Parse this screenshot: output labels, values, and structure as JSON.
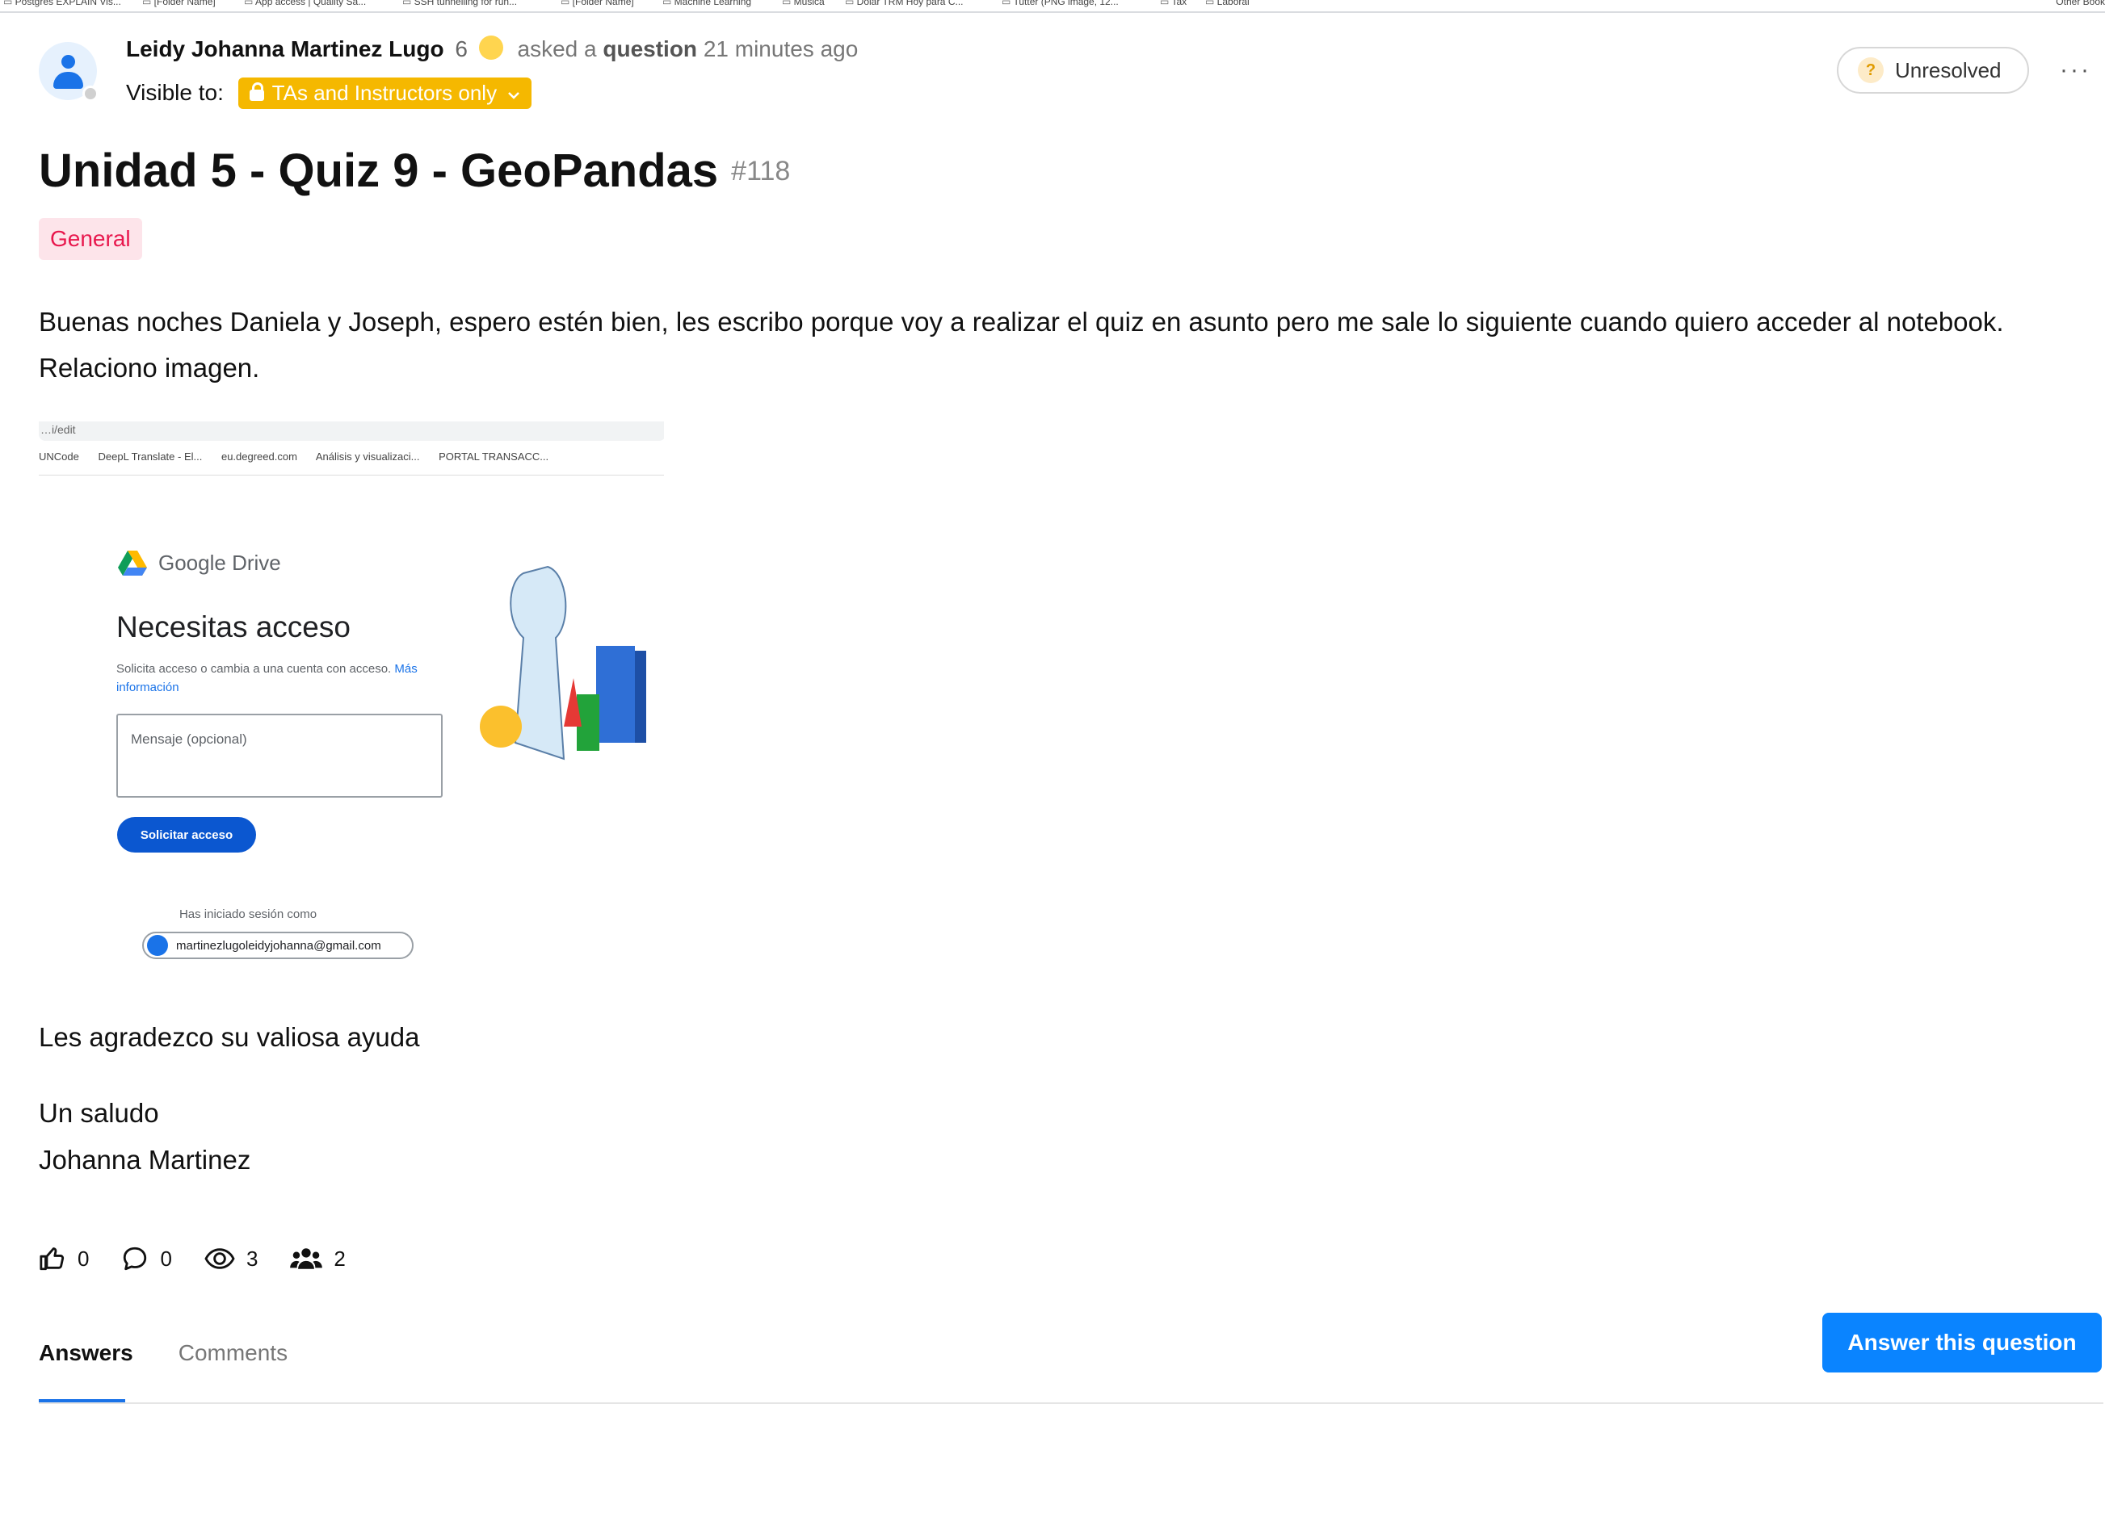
{
  "bookmarks": {
    "items": [
      "Postgres EXPLAIN Vis...",
      "[Folder Name]",
      "App access | Quality Sa...",
      "SSH tunnelling for run...",
      "[Folder Name]",
      "Machine Learning",
      "Musica",
      "Dolar TRM Hoy para C...",
      "Tutter (PNG image, 12...",
      "Tax",
      "Laboral"
    ],
    "other": "Other Book"
  },
  "post": {
    "author": "Leidy Johanna Martinez Lugo",
    "karma": "6",
    "asked_word": "asked a",
    "question_word": "question",
    "time": "21 minutes ago",
    "visible_label": "Visible to:",
    "visibility": "TAs and Instructors only",
    "status": "Unresolved",
    "more": "···",
    "title": "Unidad 5 - Quiz 9 - GeoPandas",
    "number": "#118",
    "tag": "General",
    "body_p1": "Buenas noches Daniela y Joseph, espero estén bien, les escribo porque voy a realizar el quiz en asunto pero me sale lo siguiente cuando quiero acceder al notebook. Relaciono imagen.",
    "body_p2": "Les agradezco su valiosa ayuda",
    "body_p3": "Un saludo",
    "body_p4": "Johanna Martinez"
  },
  "embedded_screenshot": {
    "url": "…i/edit",
    "bookmarks": [
      "UNCode",
      "DeepL Translate - El...",
      "eu.degreed.com",
      "Análisis y visualizaci...",
      "PORTAL TRANSACC..."
    ],
    "brand": "Google Drive",
    "heading": "Necesitas acceso",
    "subtitle": "Solicita acceso o cambia a una cuenta con acceso.",
    "subtitle_link": "Más información",
    "message_placeholder": "Mensaje (opcional)",
    "button": "Solicitar acceso",
    "signed_in_label": "Has iniciado sesión como",
    "email": "martinezlugoleidyjohanna@gmail.com"
  },
  "stats": {
    "likes": "0",
    "comments": "0",
    "views": "3",
    "participants": "2"
  },
  "tabs": {
    "answers": "Answers",
    "comments": "Comments"
  },
  "actions": {
    "answer": "Answer this question"
  },
  "colors": {
    "accent": "#0a84ff",
    "visibility_pill": "#f5b800",
    "tag_text": "#e8174d",
    "tag_bg": "#fde4ea"
  }
}
